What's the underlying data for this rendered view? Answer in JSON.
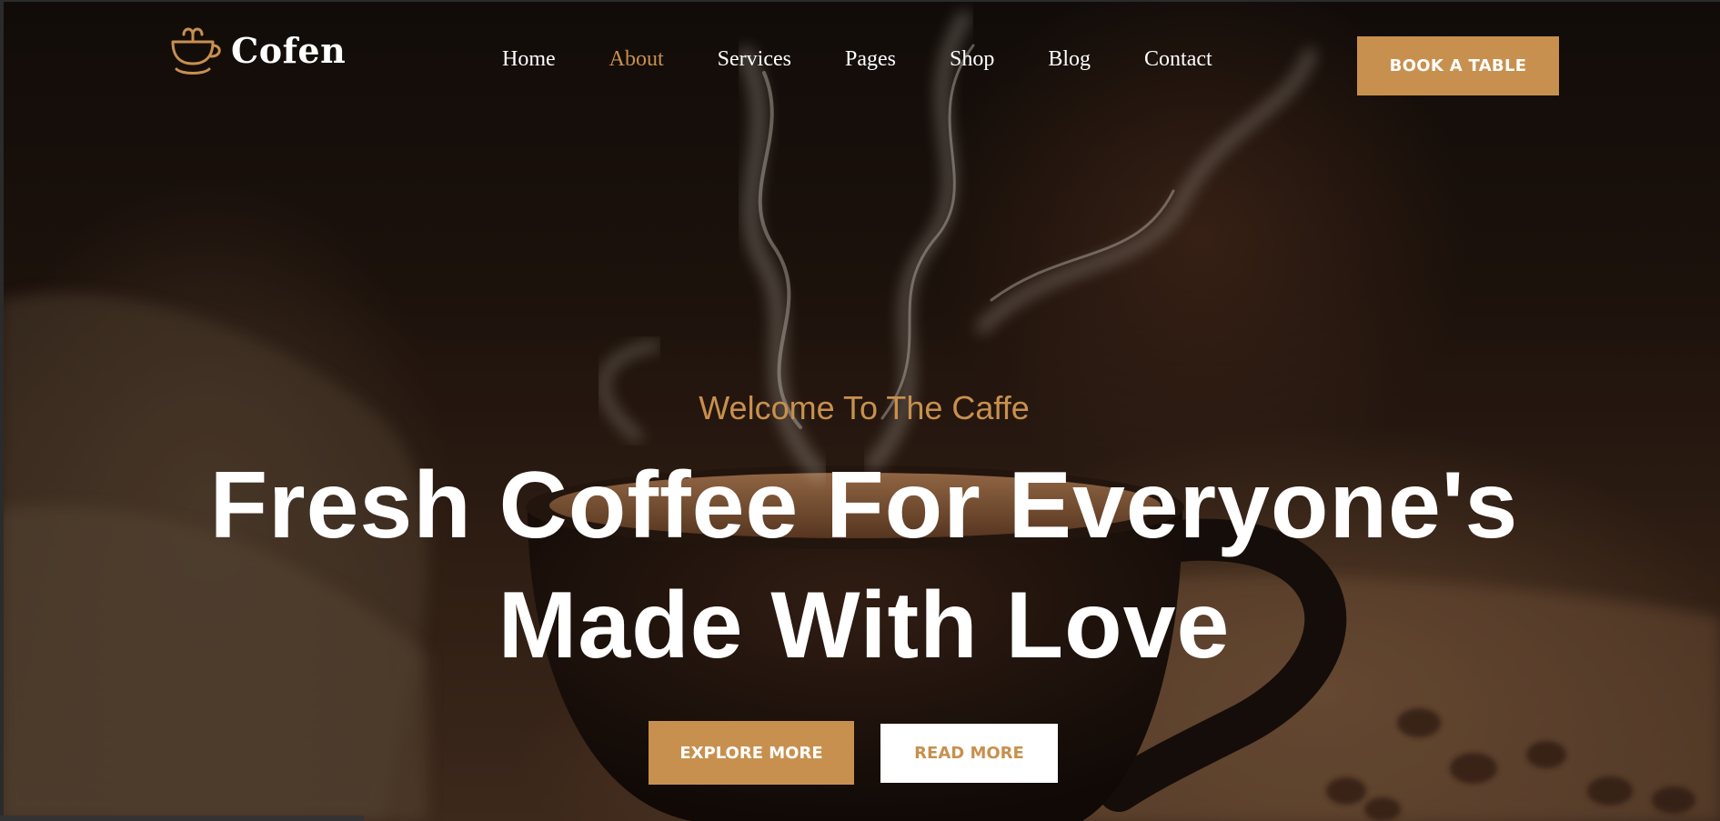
{
  "brand": {
    "name": "Cofen",
    "icon": "coffee-cup-icon",
    "accent": "#c8904e"
  },
  "nav": {
    "items": [
      {
        "label": "Home",
        "active": false
      },
      {
        "label": "About",
        "active": true
      },
      {
        "label": "Services",
        "active": false
      },
      {
        "label": "Pages",
        "active": false
      },
      {
        "label": "Shop",
        "active": false
      },
      {
        "label": "Blog",
        "active": false
      },
      {
        "label": "Contact",
        "active": false
      }
    ]
  },
  "header": {
    "cta_label": "BOOK A TABLE"
  },
  "hero": {
    "subtitle": "Welcome To The Caffe",
    "title_line1": "Fresh Coffee For Everyone's",
    "title_line2": "Made With Love",
    "primary_label": "EXPLORE MORE",
    "secondary_label": "READ MORE"
  },
  "colors": {
    "accent": "#c8904e",
    "text": "#ffffff"
  }
}
